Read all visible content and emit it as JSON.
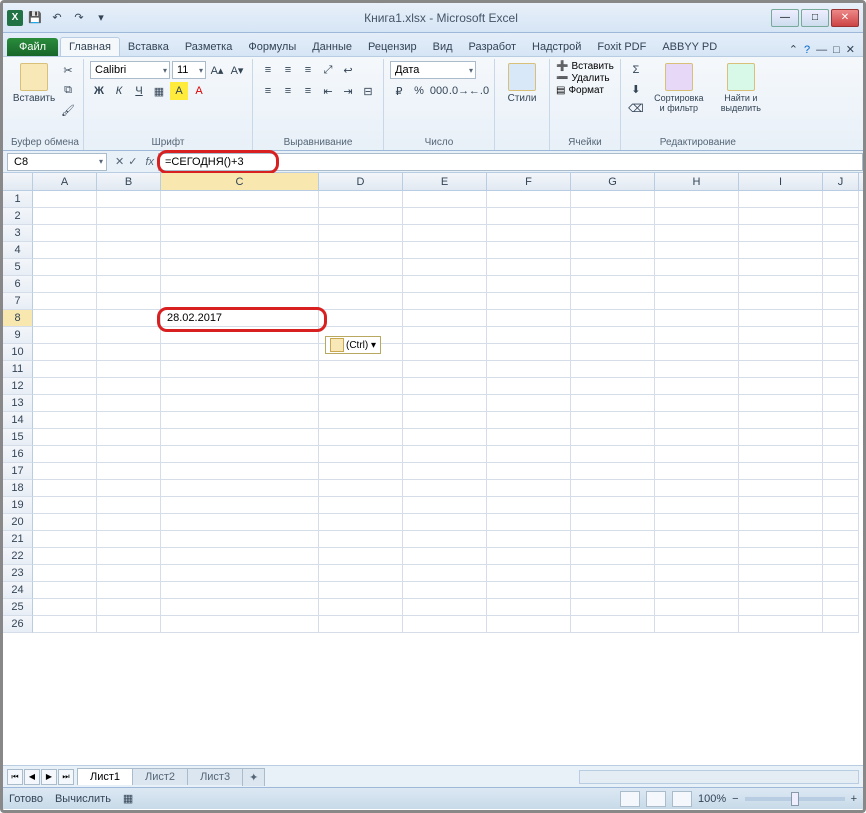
{
  "window": {
    "title": "Книга1.xlsx - Microsoft Excel"
  },
  "tabs": {
    "file": "Файл",
    "items": [
      "Главная",
      "Вставка",
      "Разметка",
      "Формулы",
      "Данные",
      "Рецензир",
      "Вид",
      "Разработ",
      "Надстрой",
      "Foxit PDF",
      "ABBYY PD"
    ],
    "active": 0
  },
  "ribbon": {
    "clipboard": {
      "label": "Буфер обмена",
      "paste": "Вставить"
    },
    "font": {
      "label": "Шрифт",
      "name": "Calibri",
      "size": "11"
    },
    "alignment": {
      "label": "Выравнивание"
    },
    "number": {
      "label": "Число",
      "format": "Дата"
    },
    "styles": {
      "label": "Стили",
      "btn": "Стили"
    },
    "cells": {
      "label": "Ячейки",
      "insert": "Вставить",
      "delete": "Удалить",
      "format": "Формат"
    },
    "editing": {
      "label": "Редактирование",
      "sort": "Сортировка и фильтр",
      "find": "Найти и выделить"
    }
  },
  "namebox": "C8",
  "formula": "=СЕГОДНЯ()+3",
  "columns": [
    "A",
    "B",
    "C",
    "D",
    "E",
    "F",
    "G",
    "H",
    "I",
    "J"
  ],
  "rowcount": 26,
  "activeCell": {
    "row": 8,
    "col": "C",
    "value": "28.02.2017"
  },
  "pasteTag": "(Ctrl) ▾",
  "sheets": {
    "items": [
      "Лист1",
      "Лист2",
      "Лист3"
    ],
    "active": 0
  },
  "status": {
    "ready": "Готово",
    "calc": "Вычислить",
    "zoom": "100%"
  }
}
